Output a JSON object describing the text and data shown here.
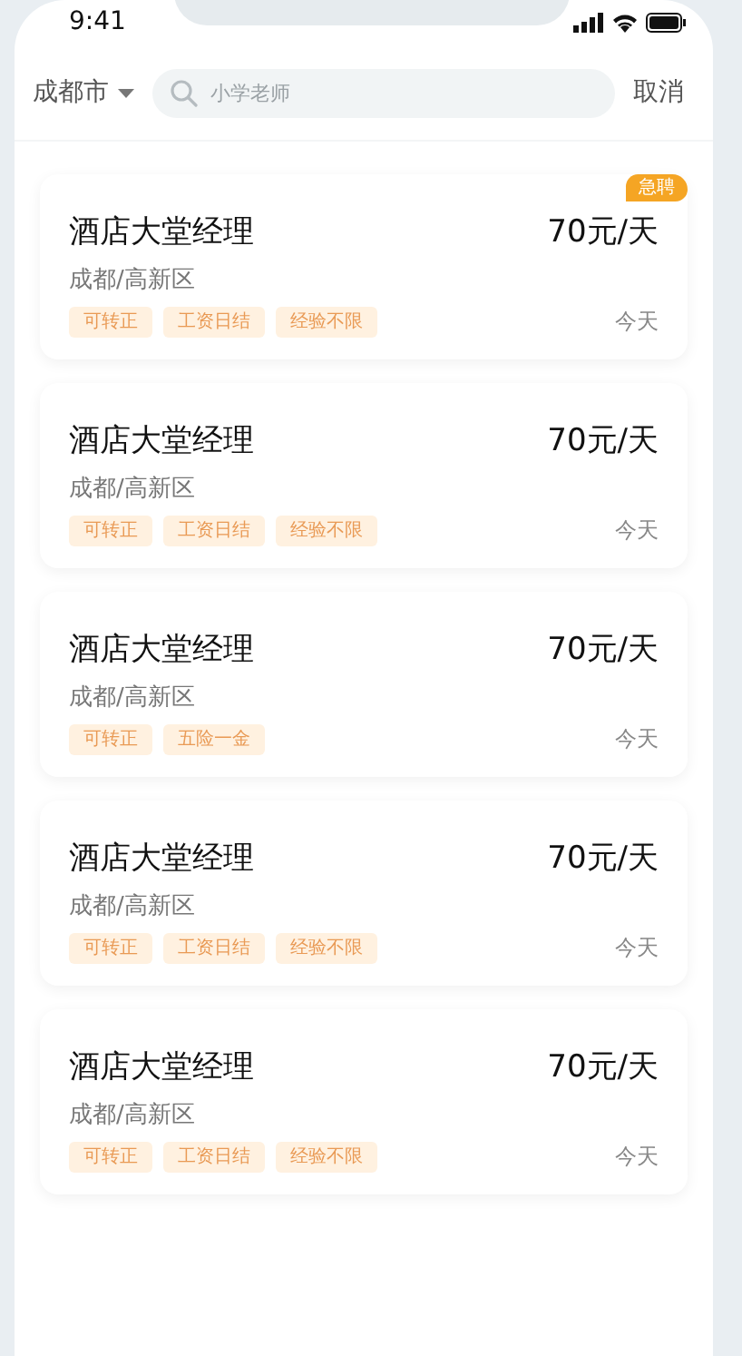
{
  "status_bar": {
    "time": "9:41"
  },
  "header": {
    "city": "成都市",
    "search": {
      "placeholder": "小学老师"
    },
    "cancel": "取消"
  },
  "jobs": [
    {
      "title": "酒店大堂经理",
      "salary": "70元/天",
      "location": "成都/高新区",
      "tags": [
        "可转正",
        "工资日结",
        "经验不限"
      ],
      "date": "今天",
      "badge": "急聘"
    },
    {
      "title": "酒店大堂经理",
      "salary": "70元/天",
      "location": "成都/高新区",
      "tags": [
        "可转正",
        "工资日结",
        "经验不限"
      ],
      "date": "今天"
    },
    {
      "title": "酒店大堂经理",
      "salary": "70元/天",
      "location": "成都/高新区",
      "tags": [
        "可转正",
        "五险一金"
      ],
      "date": "今天"
    },
    {
      "title": "酒店大堂经理",
      "salary": "70元/天",
      "location": "成都/高新区",
      "tags": [
        "可转正",
        "工资日结",
        "经验不限"
      ],
      "date": "今天"
    },
    {
      "title": "酒店大堂经理",
      "salary": "70元/天",
      "location": "成都/高新区",
      "tags": [
        "可转正",
        "工资日结",
        "经验不限"
      ],
      "date": "今天"
    }
  ]
}
